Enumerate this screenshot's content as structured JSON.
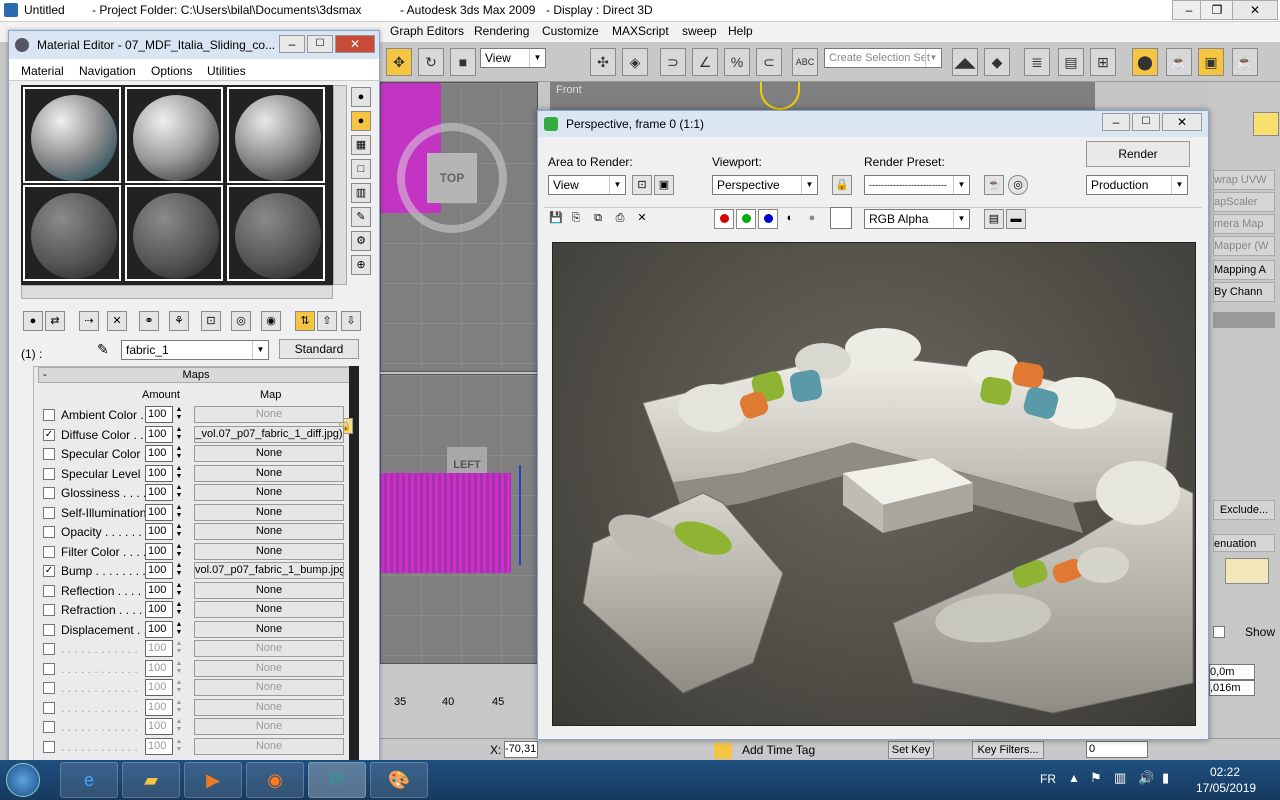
{
  "main_title": {
    "app_name": "Untitled",
    "project": "- Project Folder: C:\\Users\\bilal\\Documents\\3dsmax",
    "product": "- Autodesk 3ds Max  2009",
    "display": "- Display : Direct 3D"
  },
  "main_menu": [
    "Graph Editors",
    "Rendering",
    "Customize",
    "MAXScript",
    "sweep",
    "Help"
  ],
  "toolbar": {
    "view_dropdown": "View",
    "selection_set_placeholder": "Create Selection Set"
  },
  "viewports": {
    "top_label": "TOP",
    "left_label": "LEFT",
    "front_label": "Front"
  },
  "material_editor": {
    "title": "Material Editor - 07_MDF_Italia_Sliding_co...",
    "menu": [
      "Material",
      "Navigation",
      "Options",
      "Utilities"
    ],
    "slot_count_label": "(1) :",
    "material_name": "fabric_1",
    "material_type": "Standard",
    "maps_header": "Maps",
    "collapse_symbol": "-",
    "amount_header": "Amount",
    "map_header": "Map",
    "maps": [
      {
        "label": "Ambient Color . .",
        "checked": false,
        "amount": "100",
        "map": "None",
        "enabled": true,
        "map_dim": true
      },
      {
        "label": "Diffuse Color . . .",
        "checked": true,
        "amount": "100",
        "map": "_vol.07_p07_fabric_1_diff.jpg)",
        "enabled": true,
        "map_dim": false
      },
      {
        "label": "Specular Color . .",
        "checked": false,
        "amount": "100",
        "map": "None",
        "enabled": true,
        "map_dim": false
      },
      {
        "label": "Specular Level . .",
        "checked": false,
        "amount": "100",
        "map": "None",
        "enabled": true,
        "map_dim": false
      },
      {
        "label": "Glossiness . . . . .",
        "checked": false,
        "amount": "100",
        "map": "None",
        "enabled": true,
        "map_dim": false
      },
      {
        "label": "Self-Illumination .",
        "checked": false,
        "amount": "100",
        "map": "None",
        "enabled": true,
        "map_dim": false
      },
      {
        "label": "Opacity . . . . . . .",
        "checked": false,
        "amount": "100",
        "map": "None",
        "enabled": true,
        "map_dim": false
      },
      {
        "label": "Filter Color . . . . .",
        "checked": false,
        "amount": "100",
        "map": "None",
        "enabled": true,
        "map_dim": false
      },
      {
        "label": "Bump . . . . . . . .",
        "checked": true,
        "amount": "100",
        "map": "vol.07_p07_fabric_1_bump.jpg)",
        "enabled": true,
        "map_dim": false
      },
      {
        "label": "Reflection . . . . .",
        "checked": false,
        "amount": "100",
        "map": "None",
        "enabled": true,
        "map_dim": false
      },
      {
        "label": "Refraction . . . . .",
        "checked": false,
        "amount": "100",
        "map": "None",
        "enabled": true,
        "map_dim": false
      },
      {
        "label": "Displacement . . .",
        "checked": false,
        "amount": "100",
        "map": "None",
        "enabled": true,
        "map_dim": false
      },
      {
        "label": ". . . . . . . . . . . .",
        "checked": false,
        "amount": "100",
        "map": "None",
        "enabled": false,
        "map_dim": true
      },
      {
        "label": ". . . . . . . . . . . .",
        "checked": false,
        "amount": "100",
        "map": "None",
        "enabled": false,
        "map_dim": true
      },
      {
        "label": ". . . . . . . . . . . .",
        "checked": false,
        "amount": "100",
        "map": "None",
        "enabled": false,
        "map_dim": true
      },
      {
        "label": ". . . . . . . . . . . .",
        "checked": false,
        "amount": "100",
        "map": "None",
        "enabled": false,
        "map_dim": true
      },
      {
        "label": ". . . . . . . . . . . .",
        "checked": false,
        "amount": "100",
        "map": "None",
        "enabled": false,
        "map_dim": true
      },
      {
        "label": ". . . . . . . . . . . .",
        "checked": false,
        "amount": "100",
        "map": "None",
        "enabled": false,
        "map_dim": true
      }
    ]
  },
  "render_frame": {
    "title": "Perspective, frame 0 (1:1)",
    "area_label": "Area to Render:",
    "area_value": "View",
    "viewport_label": "Viewport:",
    "viewport_value": "Perspective",
    "preset_label": "Render Preset:",
    "preset_value": "--------------------------",
    "render_button": "Render",
    "production_value": "Production",
    "channel_value": "RGB Alpha"
  },
  "command_panel": {
    "items": [
      "wrap UVW",
      "apScaler",
      "mera Map",
      "Mapper (W",
      "Mapping A",
      "By Chann"
    ],
    "exclude_button": "Exclude...",
    "attenuation_label": "enuation",
    "show_label": "Show",
    "value1": "0,0m",
    "value2": ",016m"
  },
  "status_bar": {
    "x_label": "X:",
    "x_value": "-70,31",
    "add_time_tag": "Add Time Tag",
    "set_key": "Set Key",
    "key_filters": "Key Filters...",
    "frame_value": "0",
    "ruler": [
      "35",
      "40",
      "45"
    ]
  },
  "taskbar": {
    "language": "FR",
    "time": "02:22",
    "date": "17/05/2019"
  },
  "colors": {
    "window_title_active": "#dbe6f3",
    "taskbar": "#1f4f7f",
    "viewport_bg": "#7f7f7f",
    "selection_magenta": "#d42ad4"
  }
}
